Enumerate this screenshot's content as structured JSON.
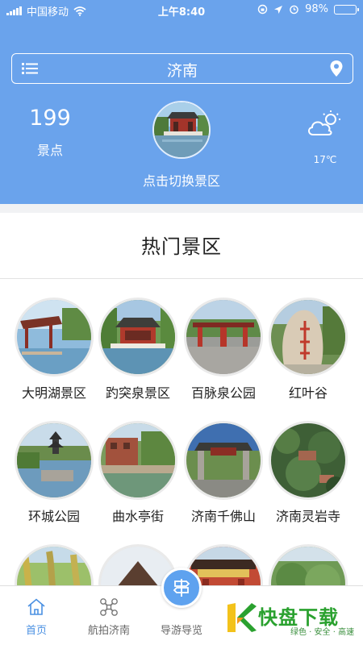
{
  "status_bar": {
    "carrier": "中国移动",
    "time": "上午8:40",
    "battery": "98%",
    "battery_level": 0.98
  },
  "header": {
    "city": "济南",
    "spot_count": "199",
    "spot_count_label": "景点",
    "switch_label": "点击切换景区",
    "temperature": "17℃",
    "icons": {
      "menu": "list-icon",
      "location": "location-pin-icon",
      "weather": "partly-sunny-icon"
    }
  },
  "section": {
    "title": "热门景区"
  },
  "spots": [
    {
      "name": "大明湖景区",
      "theme": "lake-pavilion"
    },
    {
      "name": "趵突泉景区",
      "theme": "spring-pavilion"
    },
    {
      "name": "百脉泉公园",
      "theme": "park-gate"
    },
    {
      "name": "红叶谷",
      "theme": "rock-inscription"
    },
    {
      "name": "环城公园",
      "theme": "moat-pagoda"
    },
    {
      "name": "曲水亭街",
      "theme": "canal-street"
    },
    {
      "name": "济南千佛山",
      "theme": "mountain-gate"
    },
    {
      "name": "济南灵岩寺",
      "theme": "aerial-temple"
    },
    {
      "name": "",
      "theme": "willow-trees"
    },
    {
      "name": "",
      "theme": "roof"
    },
    {
      "name": "",
      "theme": "red-arch"
    },
    {
      "name": "",
      "theme": "greenery"
    }
  ],
  "tabbar": {
    "tabs": [
      {
        "label": "首页",
        "icon": "home-icon",
        "active": true
      },
      {
        "label": "航拍济南",
        "icon": "drone-icon",
        "active": false
      },
      {
        "label": "导游导览",
        "icon": "signpost-icon",
        "active": false
      }
    ]
  },
  "watermark": {
    "title": "快盘下载",
    "subtitle": "绿色 · 安全 · 高速"
  },
  "colors": {
    "header_bg": "#6aa3ec",
    "accent": "#4a90e2",
    "watermark_green": "#2aa12f"
  }
}
